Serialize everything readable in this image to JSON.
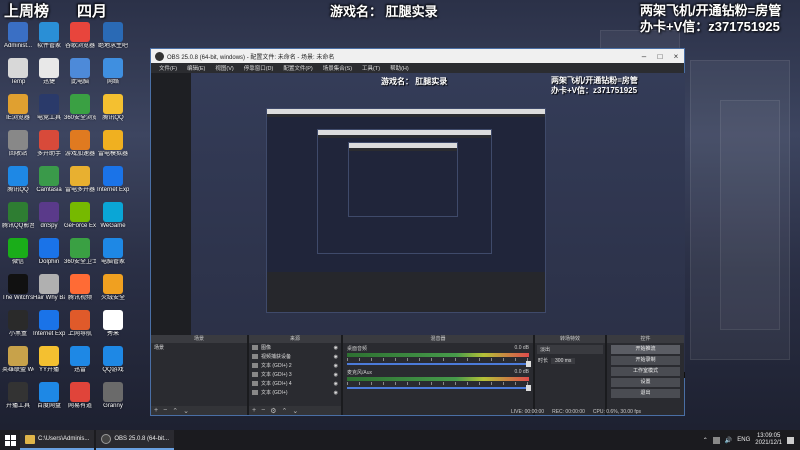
{
  "overlay": {
    "weekly_left": "上周榜",
    "weekly_right": "四月",
    "game_label": "游戏名：",
    "game_name": "肛腿实录",
    "right_line1": "两架飞机/开通钻粉=房管",
    "right_line2": "办卡+V信：z371751925"
  },
  "desktop_icons": [
    {
      "label": "Administ...",
      "color": "#3a6fc4"
    },
    {
      "label": "软件管家",
      "color": "#2a8fd6"
    },
    {
      "label": "谷歌浏览器",
      "color": "#e8453c"
    },
    {
      "label": "绝地求生吧",
      "color": "#2a6ab5"
    },
    {
      "label": "Temp",
      "color": "#d8d8d8"
    },
    {
      "label": "迅捷",
      "color": "#e8e8e8"
    },
    {
      "label": "此电脑",
      "color": "#4d8ad9"
    },
    {
      "label": "网络",
      "color": "#3f8fe0"
    },
    {
      "label": "IE浏览器",
      "color": "#e0a030"
    },
    {
      "label": "电竞工具",
      "color": "#2a3a6a"
    },
    {
      "label": "360安全浏览器",
      "color": "#3aa043"
    },
    {
      "label": "腾讯QQ",
      "color": "#f4c030"
    },
    {
      "label": "回收站",
      "color": "#888888"
    },
    {
      "label": "多开助手",
      "color": "#d84a3a"
    },
    {
      "label": "游戏加速器",
      "color": "#e07a20"
    },
    {
      "label": "雷电模拟器",
      "color": "#f0b020"
    },
    {
      "label": "腾讯QQ",
      "color": "#1e88e5"
    },
    {
      "label": "Camtasia",
      "color": "#3a9a4a"
    },
    {
      "label": "雷电多开器",
      "color": "#e8b030"
    },
    {
      "label": "Internet Explorer",
      "color": "#1a73e8"
    },
    {
      "label": "腾讯QQ影音",
      "color": "#2e7d32"
    },
    {
      "label": "dnSpy",
      "color": "#5a3a8a"
    },
    {
      "label": "GeForce Experience",
      "color": "#76b900"
    },
    {
      "label": "WeGame",
      "color": "#0aa6d6"
    },
    {
      "label": "微信",
      "color": "#1aad19"
    },
    {
      "label": "Dolphin",
      "color": "#1a73e8"
    },
    {
      "label": "360安全卫士",
      "color": "#3aa043"
    },
    {
      "label": "电脑管家",
      "color": "#1e88e5"
    },
    {
      "label": "The Witch's House MV",
      "color": "#111111"
    },
    {
      "label": "Hair Why Back Home",
      "color": "#b0b0b0"
    },
    {
      "label": "腾讯视频",
      "color": "#ff6b35"
    },
    {
      "label": "火绒安全",
      "color": "#f0a020"
    },
    {
      "label": "小黑盒",
      "color": "#2a2a2a"
    },
    {
      "label": "Internet Explorer",
      "color": "#1a73e8"
    },
    {
      "label": "上网导航",
      "color": "#e05a2a"
    },
    {
      "label": "秀米",
      "color": "#ffffff"
    },
    {
      "label": "英雄联盟 WeGame版",
      "color": "#c8a24a"
    },
    {
      "label": "YY开播",
      "color": "#f4c030"
    },
    {
      "label": "迅雷",
      "color": "#1e88e5"
    },
    {
      "label": "QQ游戏",
      "color": "#1e88e5"
    },
    {
      "label": "开播工具",
      "color": "#333333"
    },
    {
      "label": "百度网盘",
      "color": "#1e88e5"
    },
    {
      "label": "网易有道",
      "color": "#e0443a"
    },
    {
      "label": "Granny",
      "color": "#6a6a6a"
    }
  ],
  "obs": {
    "title": "OBS 25.0.8 (64-bit, windows) - 配置文件: 未命名 - 场景: 未命名",
    "menu": [
      "文件(F)",
      "编辑(E)",
      "视图(V)",
      "停靠窗口(D)",
      "配置文件(P)",
      "场景集合(S)",
      "工具(T)",
      "帮助(H)"
    ],
    "preview_game": "游戏名：  肛腿实录",
    "preview_r1": "两架飞机/开通钻粉=房管",
    "preview_r2": "办卡+V信：z371751925",
    "docks": {
      "scenes_header": "场景",
      "scene_item": "场景",
      "sources_header": "来源",
      "sources": [
        "图像",
        "视频捕获设备",
        "文本 (GDI+) 2",
        "文本 (GDI+) 3",
        "文本 (GDI+) 4",
        "文本 (GDI+)"
      ],
      "mixer_header": "混音器",
      "mixer": [
        {
          "name": "桌面音频",
          "db": "0.0 dB"
        },
        {
          "name": "麦克风/Aux",
          "db": "0.0 dB"
        }
      ],
      "transition_header": "转场特效",
      "transition_name": "淡出",
      "duration_label": "时长",
      "duration_value": "300 ms",
      "controls_header": "控件",
      "controls": [
        "开始推流",
        "开始录制",
        "工作室模式",
        "设置",
        "退出"
      ]
    },
    "status": [
      "LIVE: 00:00:00",
      "REC: 00:00:00",
      "CPU: 0.6%, 30.00 fps"
    ]
  },
  "taskbar": {
    "items": [
      {
        "label": "C:\\Users\\Adminis..."
      },
      {
        "label": "OBS 25.0.8 (64-bit..."
      }
    ],
    "lang": "ENG",
    "time": "13:09:05",
    "date": "2021/12/1"
  }
}
